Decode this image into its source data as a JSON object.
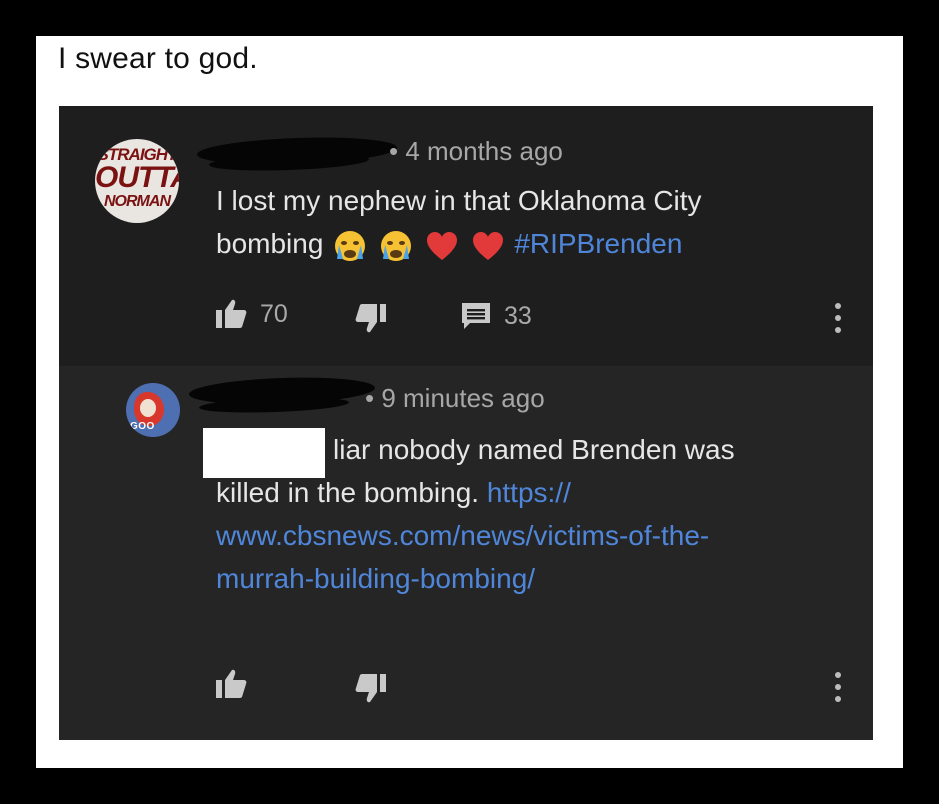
{
  "post": {
    "caption": "I swear to god."
  },
  "comment": {
    "avatar_text_1": "STRAIGHT",
    "avatar_text_2": "OUTTA",
    "avatar_text_3": "NORMAN",
    "timestamp": "• 4 months ago",
    "text_line1": "I lost my nephew in that Oklahoma City",
    "text_line2_start": "bombing",
    "hashtag": "#RIPBrenden",
    "like_count": "70",
    "reply_count": "33",
    "emojis": [
      "crying-face",
      "crying-face",
      "red-heart",
      "red-heart"
    ]
  },
  "reply": {
    "avatar_text": "GOO",
    "timestamp": "• 9 minutes ago",
    "text_line1": "liar nobody named Brenden was",
    "text_line2": "killed in the bombing.",
    "link_line1": "https://",
    "link_line2": "www.cbsnews.com/news/victims-of-the-",
    "link_line3": "murrah-building-bombing/"
  },
  "colors": {
    "background": "#000000",
    "card": "#ffffff",
    "app_dark": "#1e1e1e",
    "reply_dark": "#252525",
    "link": "#4f86d9",
    "meta_text": "#a7a7a7"
  }
}
